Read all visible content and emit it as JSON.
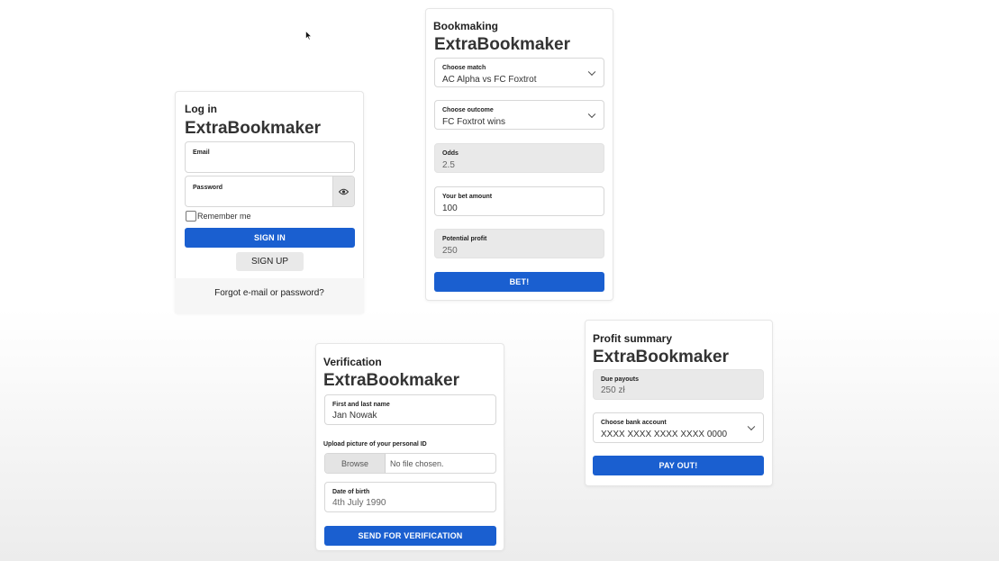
{
  "login": {
    "title": "Log in",
    "brand": "ExtraBookmaker",
    "email_label": "Email",
    "email_value": "",
    "password_label": "Password",
    "password_value": "",
    "remember_label": "Remember me",
    "sign_in_label": "SIGN IN",
    "sign_up_label": "SIGN UP",
    "forgot_label": "Forgot e-mail or password?",
    "eye_icon": "eye-icon"
  },
  "bookmaking": {
    "title": "Bookmaking",
    "brand": "ExtraBookmaker",
    "match_label": "Choose match",
    "match_value": "AC Alpha vs FC Foxtrot",
    "outcome_label": "Choose outcome",
    "outcome_value": "FC Foxtrot wins",
    "odds_label": "Odds",
    "odds_value": "2.5",
    "bet_label": "Your bet amount",
    "bet_value": "100",
    "profit_label": "Potential profit",
    "profit_value": "250",
    "bet_button": "BET!"
  },
  "verification": {
    "title": "Verification",
    "brand": "ExtraBookmaker",
    "name_label": "First and last name",
    "name_value": "Jan Nowak",
    "upload_label": "Upload picture of your personal ID",
    "browse_label": "Browse",
    "file_status": "No file chosen.",
    "dob_label": "Date of birth",
    "dob_value": "4th July 1990",
    "send_button": "SEND FOR VERIFICATION"
  },
  "profit_summary": {
    "title": "Profit summary",
    "brand": "ExtraBookmaker",
    "payouts_label": "Due payouts",
    "payouts_value": "250 zł",
    "bank_label": "Choose bank account",
    "bank_value": "XXXX XXXX XXXX XXXX 0000",
    "payout_button": "PAY OUT!"
  },
  "colors": {
    "primary": "#1a5fd0",
    "readonly_bg": "#e9e9e9",
    "border": "#d7d7d7"
  }
}
